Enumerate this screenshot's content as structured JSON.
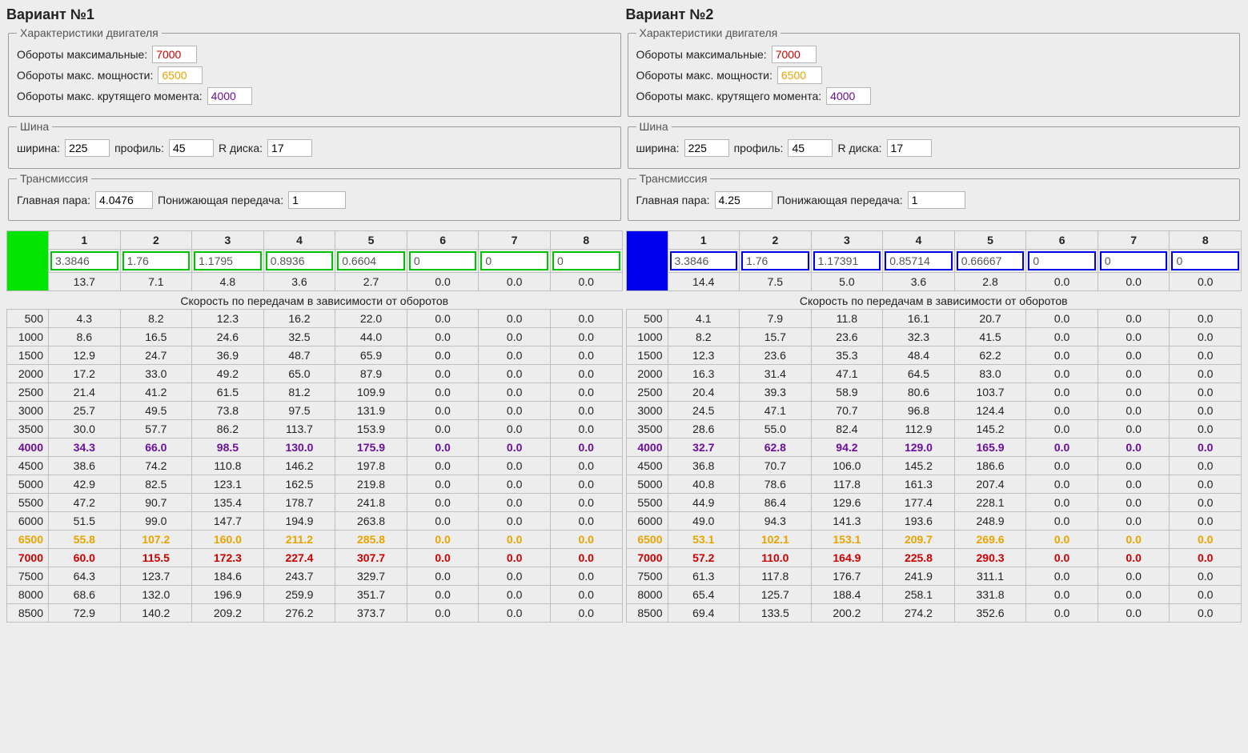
{
  "variants": [
    {
      "title": "Вариант №1",
      "ensign": "green",
      "engine": {
        "legend": "Характеристики двигателя",
        "max_label": "Обороты максимальные:",
        "max": "7000",
        "power_label": "Обороты макс. мощности:",
        "power": "6500",
        "torque_label": "Обороты макс. крутящего момента:",
        "torque": "4000"
      },
      "tire": {
        "legend": "Шина",
        "width_label": "ширина:",
        "width": "225",
        "profile_label": "профиль:",
        "profile": "45",
        "rim_label": "R диска:",
        "rim": "17"
      },
      "trans": {
        "legend": "Трансмиссия",
        "final_label": "Главная пара:",
        "final": "4.0476",
        "reduct_label": "Понижающая передача:",
        "reduct": "1"
      },
      "gear_headers": [
        "1",
        "2",
        "3",
        "4",
        "5",
        "6",
        "7",
        "8"
      ],
      "ratios": [
        "3.3846",
        "1.76",
        "1.1795",
        "0.8936",
        "0.6604",
        "0",
        "0",
        "0"
      ],
      "ratio_speeds": [
        "13.7",
        "7.1",
        "4.8",
        "3.6",
        "2.7",
        "0.0",
        "0.0",
        "0.0"
      ],
      "caption": "Скорость по передачам в зависимости от оборотов",
      "chart_data": {
        "type": "table",
        "rpm": [
          500,
          1000,
          1500,
          2000,
          2500,
          3000,
          3500,
          4000,
          4500,
          5000,
          5500,
          6000,
          6500,
          7000,
          7500,
          8000,
          8500
        ],
        "gears": [
          [
            4.3,
            8.6,
            12.9,
            17.2,
            21.4,
            25.7,
            30.0,
            34.3,
            38.6,
            42.9,
            47.2,
            51.5,
            55.8,
            60.0,
            64.3,
            68.6,
            72.9
          ],
          [
            8.2,
            16.5,
            24.7,
            33.0,
            41.2,
            49.5,
            57.7,
            66.0,
            74.2,
            82.5,
            90.7,
            99.0,
            107.2,
            115.5,
            123.7,
            132.0,
            140.2
          ],
          [
            12.3,
            24.6,
            36.9,
            49.2,
            61.5,
            73.8,
            86.2,
            98.5,
            110.8,
            123.1,
            135.4,
            147.7,
            160.0,
            172.3,
            184.6,
            196.9,
            209.2
          ],
          [
            16.2,
            32.5,
            48.7,
            65.0,
            81.2,
            97.5,
            113.7,
            130.0,
            146.2,
            162.5,
            178.7,
            194.9,
            211.2,
            227.4,
            243.7,
            259.9,
            276.2
          ],
          [
            22.0,
            44.0,
            65.9,
            87.9,
            109.9,
            131.9,
            153.9,
            175.9,
            197.8,
            219.8,
            241.8,
            263.8,
            285.8,
            307.7,
            329.7,
            351.7,
            373.7
          ],
          [
            0,
            0,
            0,
            0,
            0,
            0,
            0,
            0,
            0,
            0,
            0,
            0,
            0,
            0,
            0,
            0,
            0
          ],
          [
            0,
            0,
            0,
            0,
            0,
            0,
            0,
            0,
            0,
            0,
            0,
            0,
            0,
            0,
            0,
            0,
            0
          ],
          [
            0,
            0,
            0,
            0,
            0,
            0,
            0,
            0,
            0,
            0,
            0,
            0,
            0,
            0,
            0,
            0,
            0
          ]
        ],
        "highlight": {
          "4000": "purple",
          "6500": "orange",
          "7000": "red"
        }
      }
    },
    {
      "title": "Вариант №2",
      "ensign": "blue",
      "engine": {
        "legend": "Характеристики двигателя",
        "max_label": "Обороты максимальные:",
        "max": "7000",
        "power_label": "Обороты макс. мощности:",
        "power": "6500",
        "torque_label": "Обороты макс. крутящего момента:",
        "torque": "4000"
      },
      "tire": {
        "legend": "Шина",
        "width_label": "ширина:",
        "width": "225",
        "profile_label": "профиль:",
        "profile": "45",
        "rim_label": "R диска:",
        "rim": "17"
      },
      "trans": {
        "legend": "Трансмиссия",
        "final_label": "Главная пара:",
        "final": "4.25",
        "reduct_label": "Понижающая передача:",
        "reduct": "1"
      },
      "gear_headers": [
        "1",
        "2",
        "3",
        "4",
        "5",
        "6",
        "7",
        "8"
      ],
      "ratios": [
        "3.3846",
        "1.76",
        "1.17391",
        "0.85714",
        "0.66667",
        "0",
        "0",
        "0"
      ],
      "ratio_speeds": [
        "14.4",
        "7.5",
        "5.0",
        "3.6",
        "2.8",
        "0.0",
        "0.0",
        "0.0"
      ],
      "caption": "Скорость по передачам в зависимости от оборотов",
      "chart_data": {
        "type": "table",
        "rpm": [
          500,
          1000,
          1500,
          2000,
          2500,
          3000,
          3500,
          4000,
          4500,
          5000,
          5500,
          6000,
          6500,
          7000,
          7500,
          8000,
          8500
        ],
        "gears": [
          [
            4.1,
            8.2,
            12.3,
            16.3,
            20.4,
            24.5,
            28.6,
            32.7,
            36.8,
            40.8,
            44.9,
            49.0,
            53.1,
            57.2,
            61.3,
            65.4,
            69.4
          ],
          [
            7.9,
            15.7,
            23.6,
            31.4,
            39.3,
            47.1,
            55.0,
            62.8,
            70.7,
            78.6,
            86.4,
            94.3,
            102.1,
            110.0,
            117.8,
            125.7,
            133.5
          ],
          [
            11.8,
            23.6,
            35.3,
            47.1,
            58.9,
            70.7,
            82.4,
            94.2,
            106.0,
            117.8,
            129.6,
            141.3,
            153.1,
            164.9,
            176.7,
            188.4,
            200.2
          ],
          [
            16.1,
            32.3,
            48.4,
            64.5,
            80.6,
            96.8,
            112.9,
            129.0,
            145.2,
            161.3,
            177.4,
            193.6,
            209.7,
            225.8,
            241.9,
            258.1,
            274.2
          ],
          [
            20.7,
            41.5,
            62.2,
            83.0,
            103.7,
            124.4,
            145.2,
            165.9,
            186.6,
            207.4,
            228.1,
            248.9,
            269.6,
            290.3,
            311.1,
            331.8,
            352.6
          ],
          [
            0,
            0,
            0,
            0,
            0,
            0,
            0,
            0,
            0,
            0,
            0,
            0,
            0,
            0,
            0,
            0,
            0
          ],
          [
            0,
            0,
            0,
            0,
            0,
            0,
            0,
            0,
            0,
            0,
            0,
            0,
            0,
            0,
            0,
            0,
            0
          ],
          [
            0,
            0,
            0,
            0,
            0,
            0,
            0,
            0,
            0,
            0,
            0,
            0,
            0,
            0,
            0,
            0,
            0
          ]
        ],
        "highlight": {
          "4000": "purple",
          "6500": "orange",
          "7000": "red"
        }
      }
    }
  ]
}
